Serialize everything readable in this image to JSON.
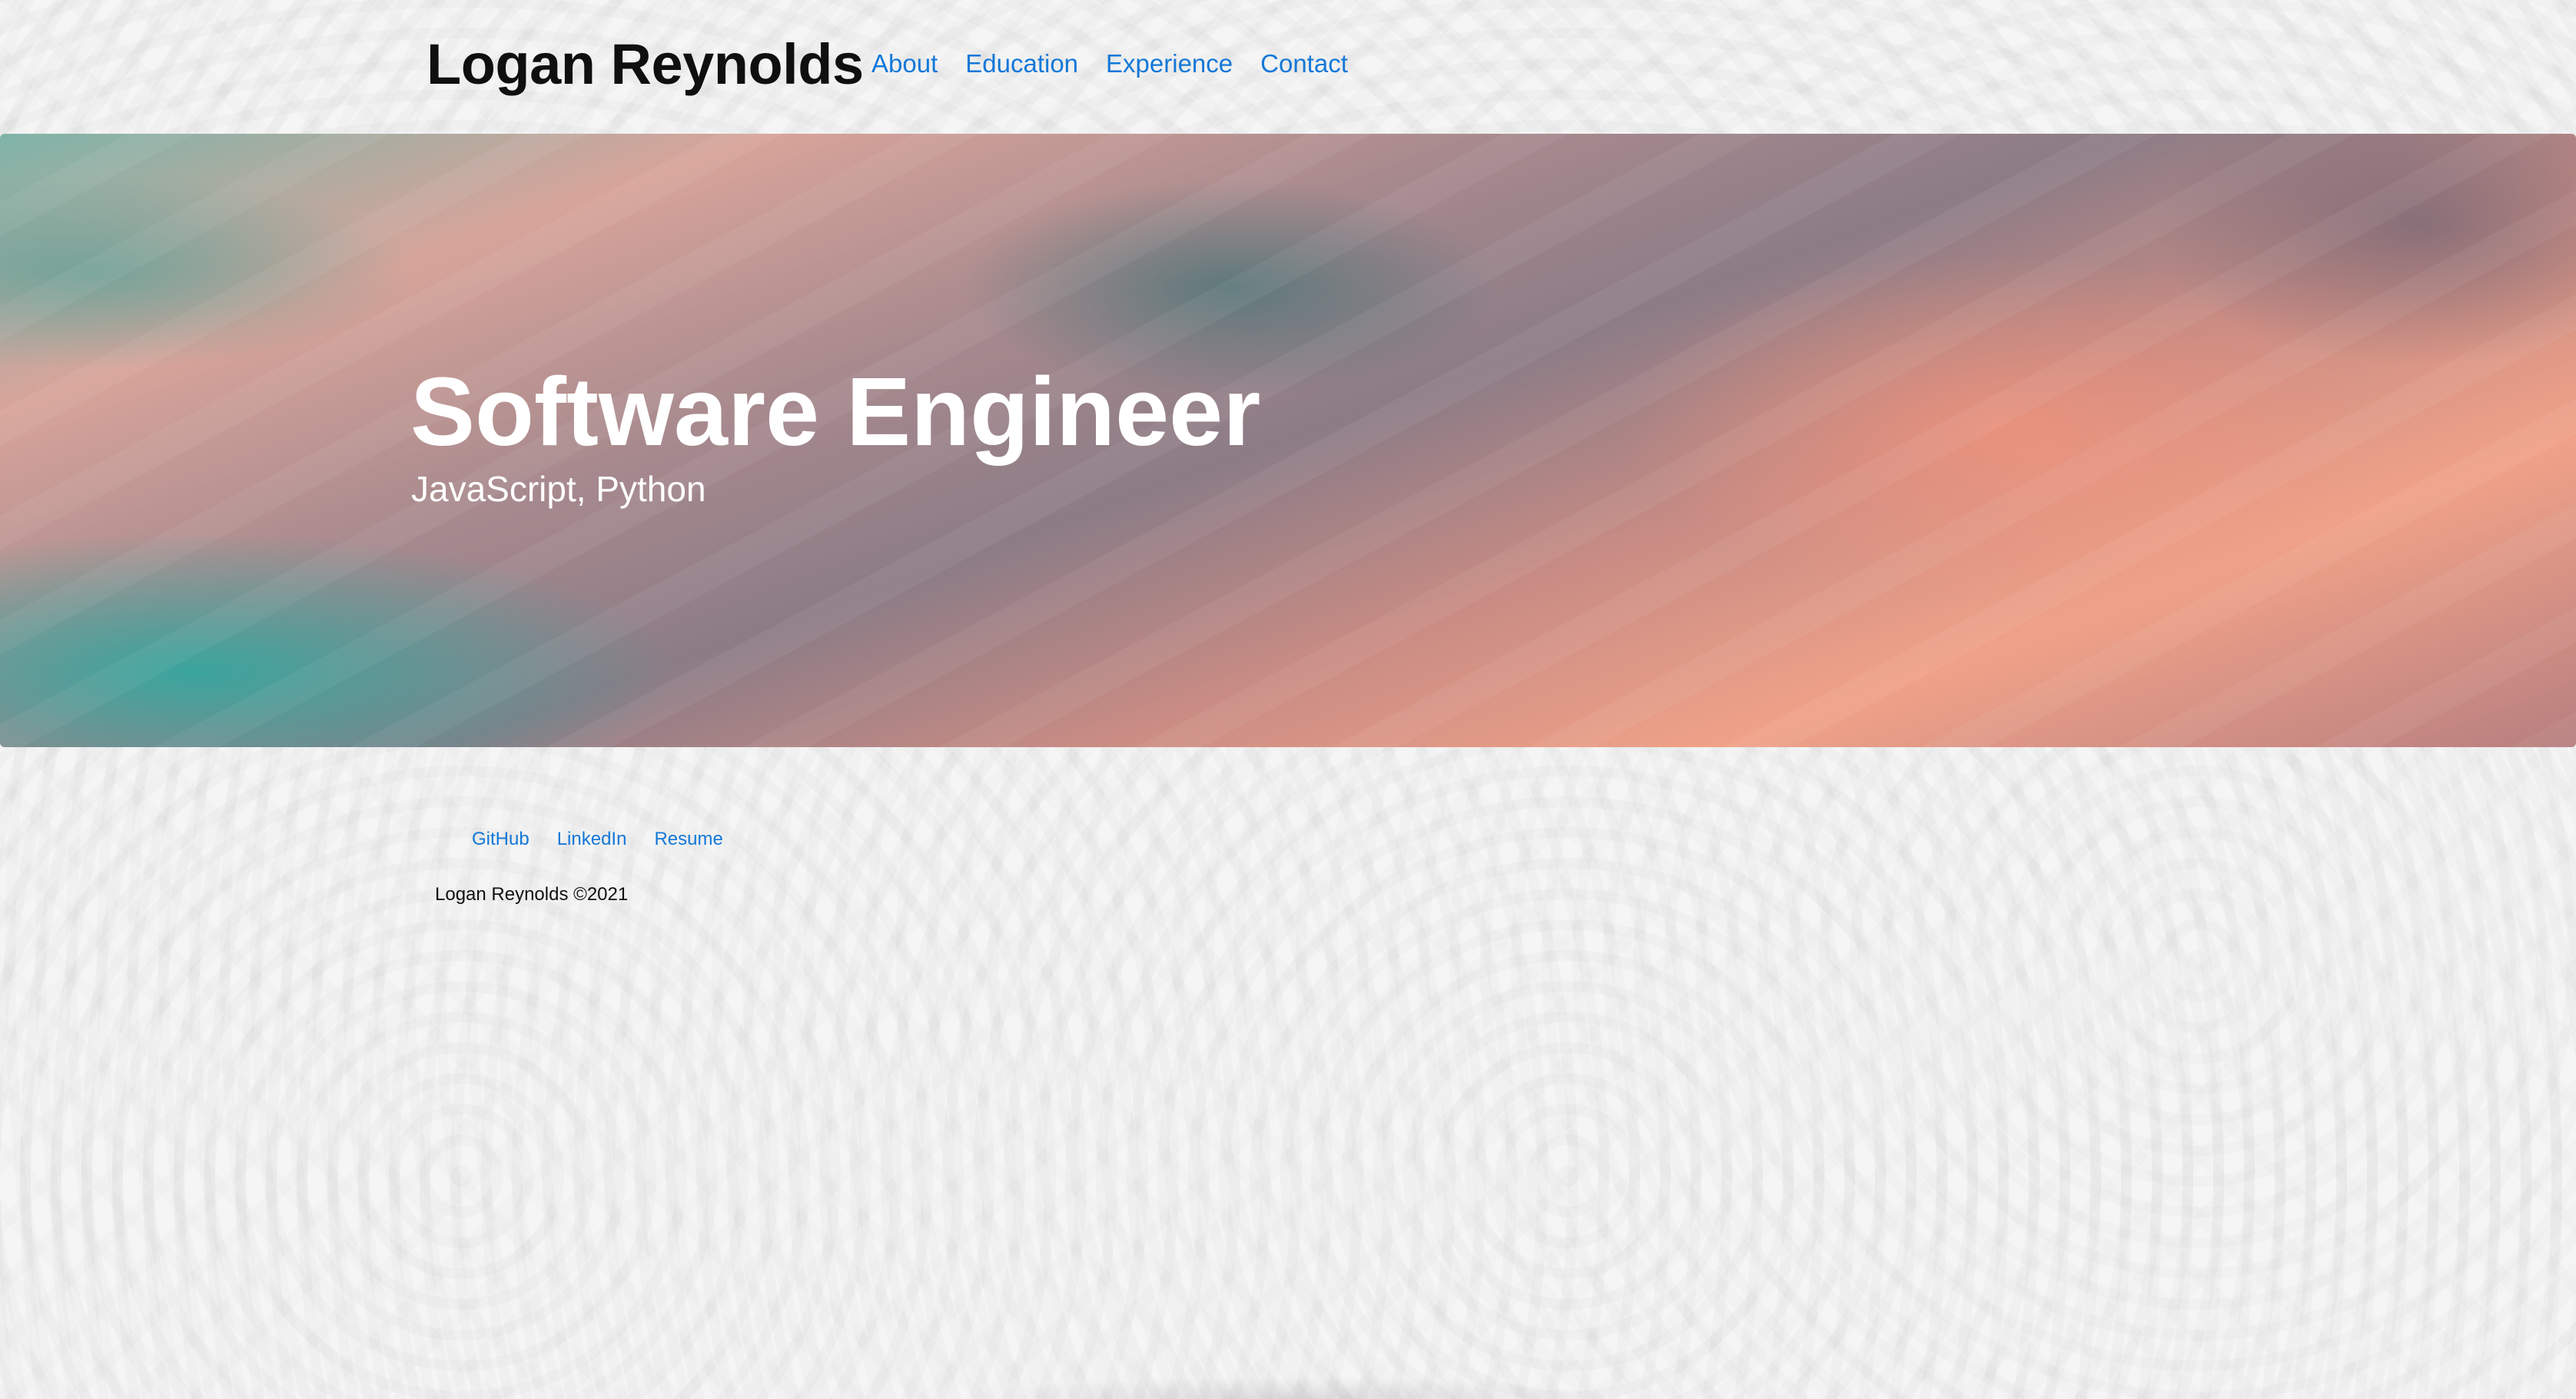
{
  "header": {
    "site_name": "Logan Reynolds",
    "nav": [
      {
        "label": "About"
      },
      {
        "label": "Education"
      },
      {
        "label": "Experience"
      },
      {
        "label": "Contact"
      }
    ]
  },
  "hero": {
    "title": "Software Engineer",
    "subtitle": "JavaScript, Python"
  },
  "footer": {
    "links": [
      {
        "label": "GitHub"
      },
      {
        "label": "LinkedIn"
      },
      {
        "label": "Resume"
      }
    ],
    "copyright": "Logan Reynolds ©2021"
  },
  "colors": {
    "link": "#1478d8",
    "background": "#f5f5f5",
    "heading": "#0f0f0f"
  }
}
